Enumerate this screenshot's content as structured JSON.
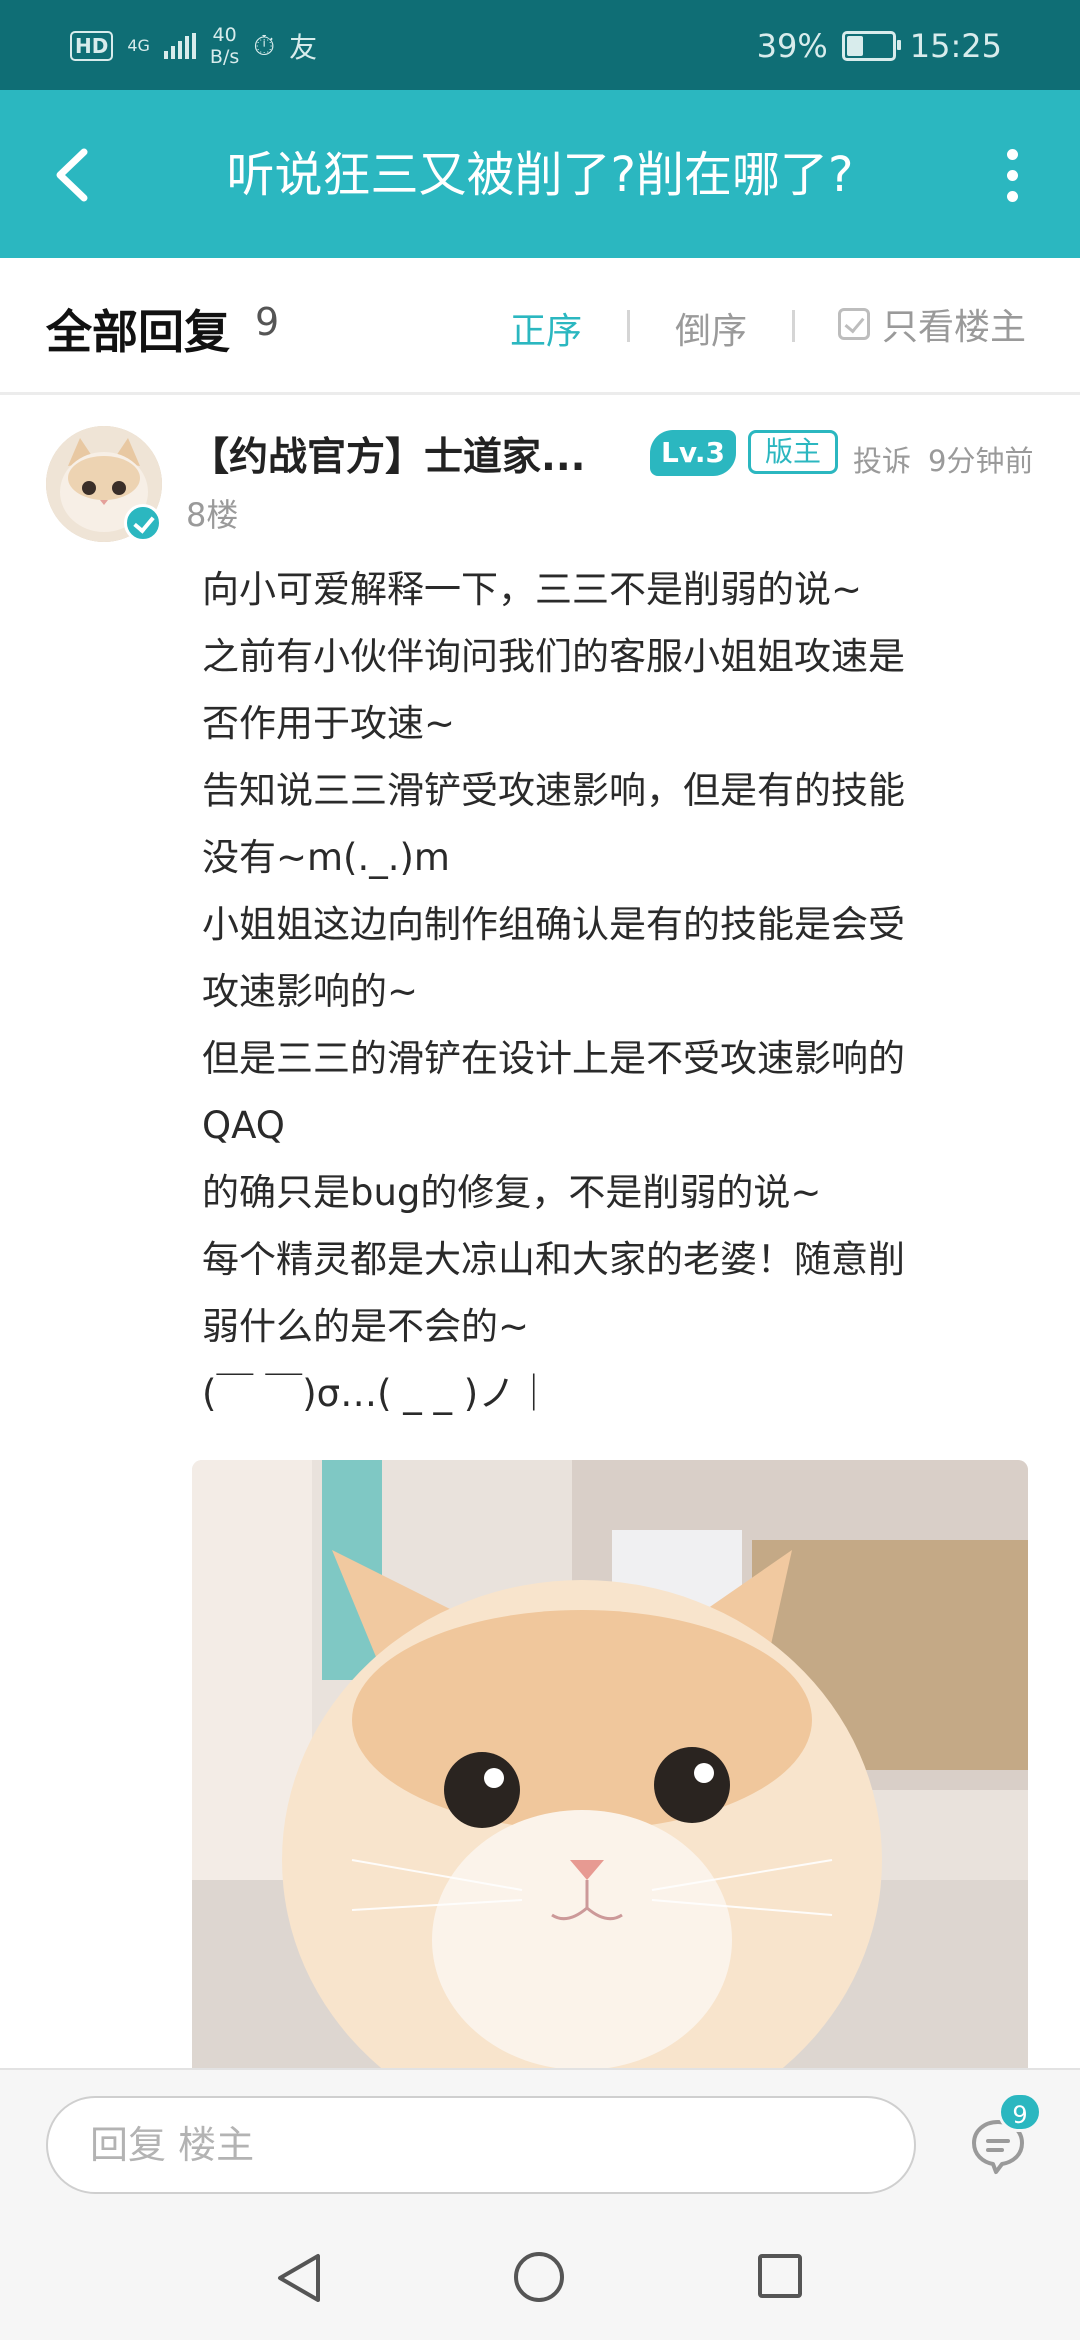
{
  "status_bar": {
    "hd": "HD",
    "signal": "4G",
    "speed_value": "40",
    "speed_unit": "B/s",
    "battery_percent": "39%",
    "battery_level": 0.39,
    "time": "15:25"
  },
  "header": {
    "title": "听说狂三又被削了?削在哪了?"
  },
  "reply_header": {
    "title": "全部回复",
    "count": "9",
    "sort_asc": "正序",
    "sort_desc": "倒序",
    "only_op": "只看楼主"
  },
  "post": {
    "username": "【约战官方】士道家...",
    "level": "Lv.3",
    "role_badge": "版主",
    "report": "投诉",
    "time": "9分钟前",
    "floor": "8楼",
    "lines": [
      "向小可爱解释一下，三三不是削弱的说~",
      "之前有小伙伴询问我们的客服小姐姐攻速是",
      "否作用于攻速~",
      "告知说三三滑铲受攻速影响，但是有的技能",
      "没有~m(._.)m",
      "小姐姐这边向制作组确认是有的技能是会受",
      "攻速影响的~",
      "但是三三的滑铲在设计上是不受攻速影响的",
      "QAQ",
      "的确只是bug的修复，不是削弱的说~",
      "每个精灵都是大凉山和大家的老婆！随意削",
      "弱什么的是不会的~",
      "(￣ ￣)σ…( _ _ )ノ｜"
    ]
  },
  "reply_bar": {
    "placeholder": "回复  楼主",
    "comments_count": "9"
  },
  "icons": {
    "back": "back-arrow-icon",
    "more": "more-vertical-icon",
    "verified": "verified-check-icon",
    "comments": "comment-bubble-icon"
  },
  "colors": {
    "accent": "#2bb7c0",
    "status_bar": "#0f6e75"
  }
}
